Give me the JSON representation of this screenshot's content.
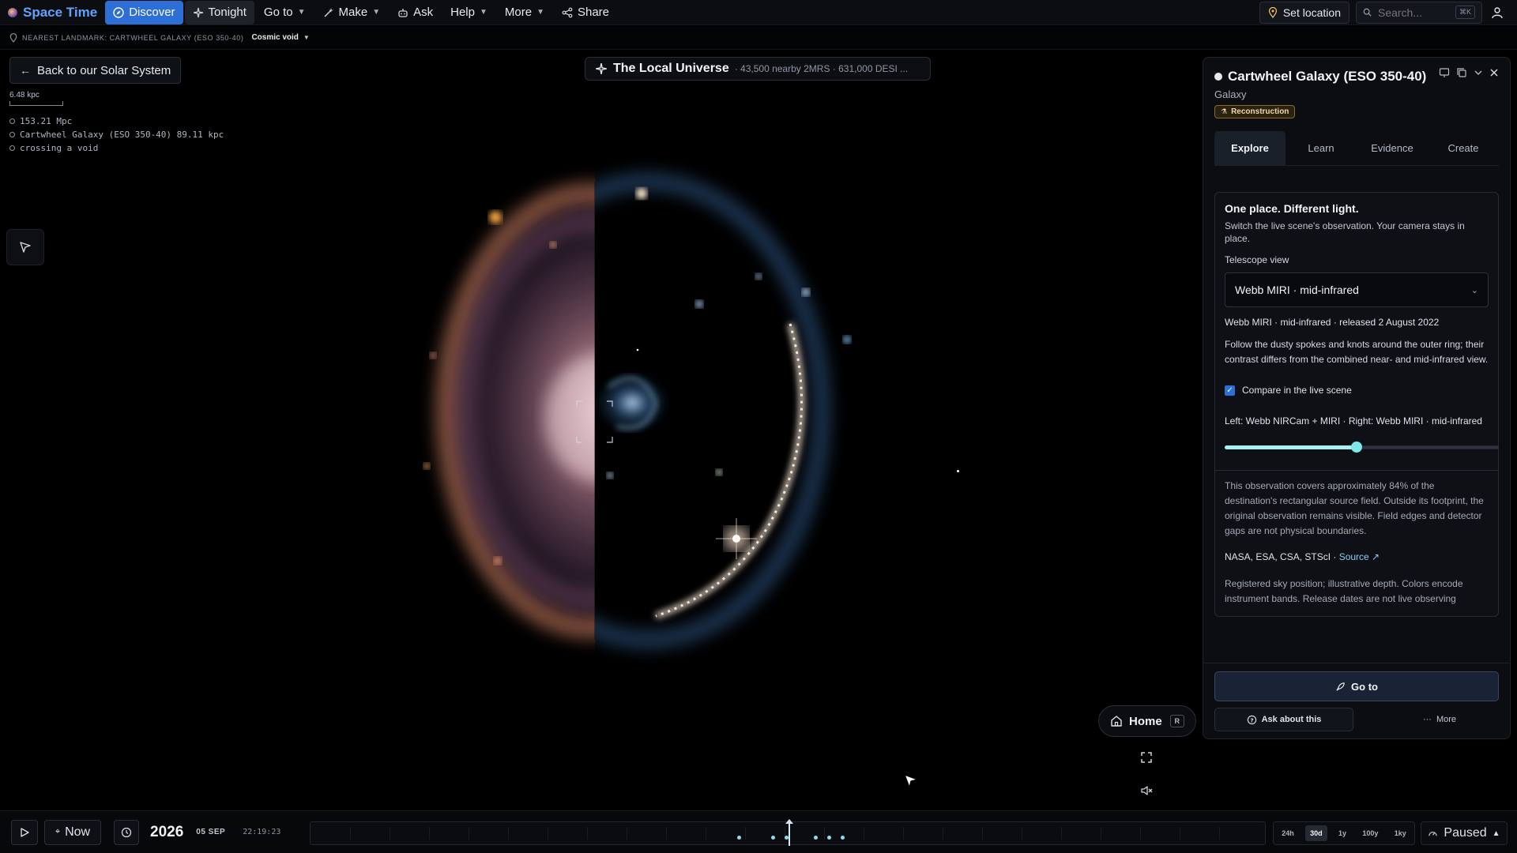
{
  "app": {
    "name": "Space Time"
  },
  "nav": {
    "discover": "Discover",
    "tonight": "Tonight",
    "goto": "Go to",
    "make": "Make",
    "ask": "Ask",
    "help": "Help",
    "more": "More",
    "share": "Share",
    "set_location": "Set location",
    "search_placeholder": "Search...",
    "search_shortcut": "⌘K"
  },
  "landmark": {
    "label": "NEAREST LANDMARK: CARTWHEEL GALAXY (ESO 350-40)",
    "region": "Cosmic void"
  },
  "overlay": {
    "back": "Back to our Solar System",
    "scale_label": "6.48 kpc",
    "readouts": [
      "153.21 Mpc",
      "Cartwheel Galaxy (ESO 350-40) 89.11 kpc",
      "crossing a void"
    ]
  },
  "universe": {
    "title": "The Local Universe",
    "subtitle": "· 43,500 nearby 2MRS · 631,000 DESI ..."
  },
  "panel": {
    "title": "Cartwheel Galaxy (ESO 350-40)",
    "type": "Galaxy",
    "badge": "Reconstruction",
    "tabs": [
      "Explore",
      "Learn",
      "Evidence",
      "Create"
    ],
    "active_tab": "Explore",
    "card_title": "One place. Different light.",
    "card_desc": "Switch the live scene's observation. Your camera stays in place.",
    "telescope_label": "Telescope view",
    "telescope_value": "Webb MIRI · mid-infrared",
    "release": "Webb MIRI · mid-infrared · released 2 August 2022",
    "body": "Follow the dusty spokes and knots around the outer ring; their contrast differs from the combined near- and mid-infrared view.",
    "compare_label": "Compare in the live scene",
    "compare_checked": true,
    "compare_desc": "Left: Webb NIRCam + MIRI · Right: Webb MIRI · mid-infrared",
    "slider_fraction": 0.5,
    "coverage": "This observation covers approximately 84% of the destination's rectangular source field. Outside its footprint, the original observation remains visible. Field edges and detector gaps are not physical boundaries.",
    "credits": "NASA, ESA, CSA, STScI · ",
    "source_link": "Source ↗",
    "repro": "Registered sky position; illustrative depth. Colors encode instrument bands. Release dates are not live observing",
    "goto": "Go to",
    "ask": "Ask about this",
    "more": "More"
  },
  "controls": {
    "home": "Home",
    "home_key": "R"
  },
  "timeline": {
    "now": "Now",
    "year": "2026",
    "date": "05 SEP",
    "time": "22:19:23",
    "zooms": [
      "24h",
      "30d",
      "1y",
      "100y",
      "1ky"
    ],
    "active_zoom": "30d",
    "status": "Paused"
  },
  "colors": {
    "accent": "#2d6fd6",
    "brand": "#5ea3ff",
    "badge": "#f2d9a4",
    "slider": "#7fe6ea"
  }
}
